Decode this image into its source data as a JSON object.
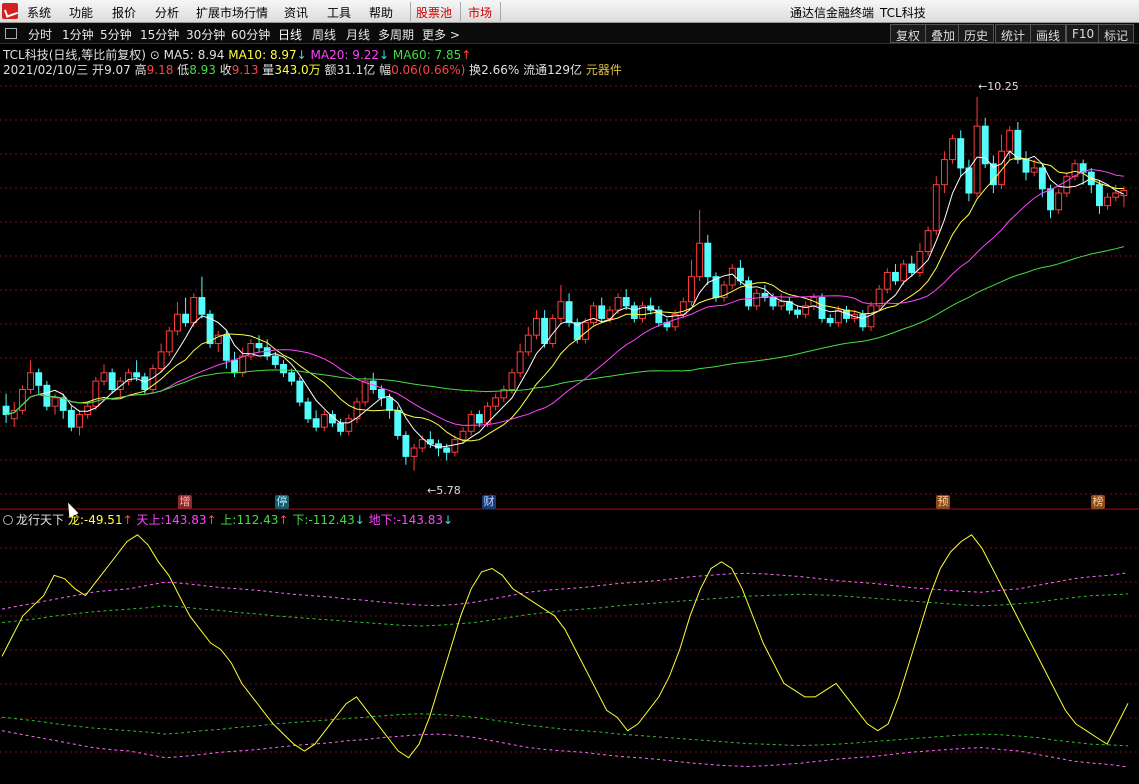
{
  "menu": {
    "items": [
      "系统",
      "功能",
      "报价",
      "分析",
      "扩展市场行情",
      "资讯",
      "工具",
      "帮助"
    ],
    "highlight": [
      "股票池",
      "市场"
    ],
    "app_title": "通达信金融终端",
    "stock_title": "TCL科技"
  },
  "periods": [
    "分时",
    "1分钟",
    "5分钟",
    "15分钟",
    "30分钟",
    "60分钟",
    "日线",
    "周线",
    "月线",
    "多周期",
    "更多 >"
  ],
  "right_buttons": [
    "复权",
    "叠加",
    "历史",
    "统计",
    "画线",
    "F10",
    "标记"
  ],
  "header": {
    "stock": "TCL科技",
    "mode": "(日线,等比前复权)",
    "ma5_label": "MA5:",
    "ma5": "8.94",
    "ma10_label": "MA10:",
    "ma10": "8.97",
    "ma20_label": "MA20:",
    "ma20": "9.22",
    "ma60_label": "MA60:",
    "ma60": "7.85"
  },
  "quote": {
    "date": "2021/02/10/三",
    "open_label": "开",
    "open": "9.07",
    "high_label": "高",
    "high": "9.18",
    "low_label": "低",
    "low": "8.93",
    "close_label": "收",
    "close": "9.13",
    "vol_label": "量",
    "vol": "343.0万",
    "amt_label": "额",
    "amt": "31.1亿",
    "chg_label": "幅",
    "chg": "0.06(0.66%)",
    "turn_label": "换",
    "turn": "2.66%",
    "float_label": "流通",
    "float": "129亿",
    "sector": "元器件"
  },
  "annotations": {
    "high_mark": "10.25",
    "low_mark": "5.78"
  },
  "events": [
    "增",
    "停",
    "财",
    "预",
    "榜"
  ],
  "indicator": {
    "name": "龙行天下",
    "long_label": "龙:",
    "long": "-49.51",
    "up_sky_label": "天上:",
    "up_sky": "143.83",
    "up_label": "上:",
    "up": "112.43",
    "down_label": "下:",
    "down": "-112.43",
    "under_label": "地下:",
    "under": "-143.83"
  },
  "colors": {
    "up": "#ff3c3c",
    "down": "#54fcfc",
    "ma5": "#ffffff",
    "ma10": "#ffff44",
    "ma20": "#ff44ff",
    "ma60": "#44dd44",
    "grid": "#7a1010"
  },
  "chart_data": {
    "type": "candlestick",
    "price_range": [
      5.5,
      10.5
    ],
    "candles": [
      [
        6.55,
        6.45,
        6.7,
        6.35
      ],
      [
        6.4,
        6.5,
        6.6,
        6.3
      ],
      [
        6.5,
        6.75,
        6.8,
        6.45
      ],
      [
        6.75,
        6.95,
        7.1,
        6.7
      ],
      [
        6.95,
        6.8,
        7.0,
        6.7
      ],
      [
        6.8,
        6.55,
        6.85,
        6.5
      ],
      [
        6.55,
        6.65,
        6.7,
        6.45
      ],
      [
        6.65,
        6.5,
        6.7,
        6.4
      ],
      [
        6.5,
        6.3,
        6.55,
        6.25
      ],
      [
        6.3,
        6.45,
        6.5,
        6.2
      ],
      [
        6.45,
        6.55,
        6.6,
        6.4
      ],
      [
        6.55,
        6.85,
        6.9,
        6.5
      ],
      [
        6.85,
        6.95,
        7.05,
        6.8
      ],
      [
        6.95,
        6.75,
        7.0,
        6.7
      ],
      [
        6.75,
        6.85,
        6.9,
        6.65
      ],
      [
        6.85,
        6.95,
        7.0,
        6.8
      ],
      [
        6.95,
        6.9,
        7.1,
        6.85
      ],
      [
        6.9,
        6.75,
        6.95,
        6.7
      ],
      [
        6.75,
        7.0,
        7.05,
        6.7
      ],
      [
        7.0,
        7.2,
        7.3,
        6.95
      ],
      [
        7.2,
        7.45,
        7.5,
        7.15
      ],
      [
        7.45,
        7.65,
        7.8,
        7.4
      ],
      [
        7.65,
        7.55,
        7.85,
        7.5
      ],
      [
        7.55,
        7.85,
        7.9,
        7.5
      ],
      [
        7.85,
        7.65,
        8.1,
        7.6
      ],
      [
        7.65,
        7.3,
        7.7,
        7.25
      ],
      [
        7.3,
        7.4,
        7.45,
        7.2
      ],
      [
        7.4,
        7.1,
        7.45,
        7.0
      ],
      [
        7.1,
        6.95,
        7.2,
        6.9
      ],
      [
        6.95,
        7.15,
        7.25,
        6.9
      ],
      [
        7.15,
        7.3,
        7.35,
        7.1
      ],
      [
        7.3,
        7.25,
        7.4,
        7.2
      ],
      [
        7.25,
        7.15,
        7.35,
        7.1
      ],
      [
        7.15,
        7.05,
        7.2,
        7.0
      ],
      [
        7.05,
        6.95,
        7.1,
        6.9
      ],
      [
        6.95,
        6.85,
        7.0,
        6.8
      ],
      [
        6.85,
        6.6,
        6.9,
        6.55
      ],
      [
        6.6,
        6.4,
        6.65,
        6.35
      ],
      [
        6.4,
        6.3,
        6.5,
        6.25
      ],
      [
        6.3,
        6.45,
        6.5,
        6.25
      ],
      [
        6.45,
        6.35,
        6.5,
        6.3
      ],
      [
        6.35,
        6.25,
        6.4,
        6.2
      ],
      [
        6.25,
        6.4,
        6.45,
        6.2
      ],
      [
        6.4,
        6.6,
        6.65,
        6.35
      ],
      [
        6.6,
        6.85,
        6.9,
        6.55
      ],
      [
        6.85,
        6.75,
        6.95,
        6.7
      ],
      [
        6.75,
        6.65,
        6.8,
        6.55
      ],
      [
        6.65,
        6.5,
        6.7,
        6.4
      ],
      [
        6.5,
        6.2,
        6.55,
        6.15
      ],
      [
        6.2,
        5.95,
        6.25,
        5.85
      ],
      [
        5.95,
        6.05,
        6.1,
        5.78
      ],
      [
        6.05,
        6.15,
        6.2,
        6.0
      ],
      [
        6.15,
        6.1,
        6.25,
        6.05
      ],
      [
        6.1,
        6.05,
        6.15,
        5.95
      ],
      [
        6.05,
        6.0,
        6.1,
        5.9
      ],
      [
        6.0,
        6.15,
        6.2,
        5.95
      ],
      [
        6.15,
        6.25,
        6.3,
        6.1
      ],
      [
        6.25,
        6.45,
        6.5,
        6.2
      ],
      [
        6.45,
        6.35,
        6.5,
        6.3
      ],
      [
        6.35,
        6.55,
        6.6,
        6.3
      ],
      [
        6.55,
        6.65,
        6.7,
        6.5
      ],
      [
        6.65,
        6.75,
        6.8,
        6.6
      ],
      [
        6.75,
        6.95,
        7.0,
        6.7
      ],
      [
        6.95,
        7.2,
        7.3,
        6.9
      ],
      [
        7.2,
        7.4,
        7.5,
        7.15
      ],
      [
        7.4,
        7.6,
        7.7,
        7.35
      ],
      [
        7.6,
        7.3,
        7.7,
        7.25
      ],
      [
        7.3,
        7.6,
        7.65,
        7.25
      ],
      [
        7.6,
        7.8,
        8.0,
        7.55
      ],
      [
        7.8,
        7.55,
        7.9,
        7.5
      ],
      [
        7.55,
        7.35,
        7.6,
        7.3
      ],
      [
        7.35,
        7.55,
        7.6,
        7.3
      ],
      [
        7.55,
        7.75,
        7.8,
        7.5
      ],
      [
        7.75,
        7.6,
        7.85,
        7.55
      ],
      [
        7.6,
        7.7,
        7.75,
        7.55
      ],
      [
        7.7,
        7.85,
        7.9,
        7.65
      ],
      [
        7.85,
        7.75,
        7.95,
        7.7
      ],
      [
        7.75,
        7.6,
        7.8,
        7.55
      ],
      [
        7.6,
        7.75,
        7.8,
        7.55
      ],
      [
        7.75,
        7.7,
        7.85,
        7.65
      ],
      [
        7.7,
        7.55,
        7.75,
        7.5
      ],
      [
        7.55,
        7.5,
        7.6,
        7.45
      ],
      [
        7.5,
        7.65,
        7.7,
        7.45
      ],
      [
        7.65,
        7.8,
        7.85,
        7.6
      ],
      [
        7.8,
        8.1,
        8.3,
        7.75
      ],
      [
        8.1,
        8.5,
        8.9,
        8.05
      ],
      [
        8.5,
        8.1,
        8.6,
        8.0
      ],
      [
        8.1,
        7.85,
        8.15,
        7.8
      ],
      [
        7.85,
        8.0,
        8.05,
        7.8
      ],
      [
        8.0,
        8.2,
        8.25,
        7.95
      ],
      [
        8.2,
        8.05,
        8.3,
        8.0
      ],
      [
        8.05,
        7.75,
        8.1,
        7.7
      ],
      [
        7.75,
        7.9,
        7.95,
        7.7
      ],
      [
        7.9,
        7.85,
        8.0,
        7.8
      ],
      [
        7.85,
        7.75,
        7.9,
        7.7
      ],
      [
        7.75,
        7.8,
        7.9,
        7.7
      ],
      [
        7.8,
        7.7,
        7.85,
        7.65
      ],
      [
        7.7,
        7.65,
        7.75,
        7.6
      ],
      [
        7.65,
        7.75,
        7.8,
        7.6
      ],
      [
        7.75,
        7.85,
        7.9,
        7.7
      ],
      [
        7.85,
        7.6,
        7.9,
        7.55
      ],
      [
        7.6,
        7.55,
        7.65,
        7.5
      ],
      [
        7.55,
        7.7,
        7.75,
        7.5
      ],
      [
        7.7,
        7.6,
        7.75,
        7.55
      ],
      [
        7.6,
        7.65,
        7.7,
        7.55
      ],
      [
        7.65,
        7.5,
        7.7,
        7.45
      ],
      [
        7.5,
        7.75,
        7.8,
        7.45
      ],
      [
        7.75,
        7.95,
        8.0,
        7.7
      ],
      [
        7.95,
        8.15,
        8.2,
        7.9
      ],
      [
        8.15,
        8.05,
        8.25,
        8.0
      ],
      [
        8.05,
        8.25,
        8.3,
        8.0
      ],
      [
        8.25,
        8.15,
        8.35,
        8.1
      ],
      [
        8.15,
        8.4,
        8.5,
        8.1
      ],
      [
        8.4,
        8.65,
        8.7,
        8.35
      ],
      [
        8.65,
        9.2,
        9.3,
        8.6
      ],
      [
        9.2,
        9.5,
        9.6,
        9.1
      ],
      [
        9.5,
        9.75,
        9.8,
        9.45
      ],
      [
        9.75,
        9.4,
        9.85,
        9.3
      ],
      [
        9.4,
        9.1,
        9.5,
        9.0
      ],
      [
        9.1,
        9.9,
        10.25,
        9.05
      ],
      [
        9.9,
        9.45,
        10.0,
        9.4
      ],
      [
        9.45,
        9.2,
        9.55,
        9.1
      ],
      [
        9.2,
        9.6,
        9.8,
        9.15
      ],
      [
        9.6,
        9.85,
        9.9,
        9.5
      ],
      [
        9.85,
        9.5,
        9.95,
        9.45
      ],
      [
        9.5,
        9.35,
        9.6,
        9.25
      ],
      [
        9.35,
        9.4,
        9.5,
        9.3
      ],
      [
        9.4,
        9.15,
        9.45,
        9.05
      ],
      [
        9.15,
        8.9,
        9.2,
        8.8
      ],
      [
        8.9,
        9.1,
        9.15,
        8.85
      ],
      [
        9.1,
        9.3,
        9.35,
        9.05
      ],
      [
        9.3,
        9.45,
        9.5,
        9.25
      ],
      [
        9.45,
        9.35,
        9.5,
        9.2
      ],
      [
        9.35,
        9.2,
        9.4,
        9.1
      ],
      [
        9.2,
        8.95,
        9.25,
        8.85
      ],
      [
        8.95,
        9.05,
        9.1,
        8.9
      ],
      [
        9.05,
        9.1,
        9.2,
        9.0
      ],
      [
        9.07,
        9.13,
        9.18,
        8.93
      ]
    ],
    "indicator_series": {
      "long": [
        20,
        50,
        80,
        95,
        110,
        140,
        135,
        120,
        110,
        130,
        150,
        170,
        190,
        200,
        185,
        160,
        140,
        110,
        80,
        60,
        40,
        30,
        10,
        -20,
        -40,
        -60,
        -80,
        -95,
        -110,
        -120,
        -110,
        -90,
        -70,
        -50,
        -40,
        -60,
        -80,
        -100,
        -120,
        -130,
        -110,
        -70,
        -20,
        30,
        80,
        120,
        145,
        150,
        140,
        120,
        110,
        100,
        90,
        80,
        60,
        30,
        0,
        -30,
        -60,
        -70,
        -90,
        -80,
        -60,
        -40,
        -10,
        30,
        80,
        120,
        150,
        160,
        150,
        120,
        80,
        40,
        10,
        -20,
        -30,
        -40,
        -40,
        -30,
        -20,
        -40,
        -60,
        -80,
        -90,
        -80,
        -40,
        10,
        60,
        110,
        150,
        175,
        190,
        200,
        180,
        150,
        120,
        90,
        60,
        30,
        0,
        -30,
        -60,
        -80,
        -90,
        -100,
        -110,
        -80,
        -49.51
      ],
      "sky": [
        90,
        95,
        100,
        105,
        110,
        115,
        118,
        120,
        125,
        130,
        128,
        125,
        122,
        120,
        118,
        115,
        112,
        110,
        108,
        105,
        103,
        100,
        98,
        96,
        95,
        97,
        100,
        105,
        110,
        115,
        118,
        120,
        122,
        125,
        128,
        130,
        132,
        135,
        138,
        140,
        142,
        143,
        142,
        140,
        138,
        135,
        132,
        130,
        128,
        125,
        122,
        120,
        118,
        116,
        115,
        118,
        120,
        125,
        130,
        135,
        138,
        140,
        143.83
      ],
      "up": [
        70,
        73,
        76,
        80,
        83,
        86,
        88,
        90,
        92,
        95,
        93,
        90,
        88,
        85,
        83,
        80,
        78,
        76,
        74,
        72,
        70,
        68,
        66,
        65,
        66,
        68,
        70,
        74,
        78,
        82,
        85,
        88,
        90,
        92,
        95,
        97,
        99,
        101,
        103,
        105,
        107,
        109,
        110,
        111,
        112,
        111,
        110,
        108,
        106,
        104,
        102,
        100,
        98,
        96,
        95,
        96,
        98,
        100,
        104,
        107,
        110,
        111,
        112.43
      ],
      "down": [
        -70,
        -73,
        -76,
        -80,
        -83,
        -86,
        -88,
        -90,
        -92,
        -95,
        -93,
        -90,
        -88,
        -85,
        -83,
        -80,
        -78,
        -76,
        -74,
        -72,
        -70,
        -68,
        -66,
        -65,
        -66,
        -68,
        -70,
        -74,
        -78,
        -82,
        -85,
        -88,
        -90,
        -92,
        -95,
        -97,
        -99,
        -101,
        -103,
        -105,
        -107,
        -109,
        -110,
        -111,
        -112,
        -111,
        -110,
        -108,
        -106,
        -104,
        -102,
        -100,
        -98,
        -96,
        -95,
        -96,
        -98,
        -100,
        -104,
        -107,
        -110,
        -111,
        -112.43
      ],
      "ground": [
        -90,
        -95,
        -100,
        -105,
        -110,
        -115,
        -118,
        -120,
        -125,
        -130,
        -128,
        -125,
        -122,
        -120,
        -118,
        -115,
        -112,
        -110,
        -108,
        -105,
        -103,
        -100,
        -98,
        -96,
        -95,
        -97,
        -100,
        -105,
        -110,
        -115,
        -118,
        -120,
        -122,
        -125,
        -128,
        -130,
        -132,
        -135,
        -138,
        -140,
        -142,
        -143,
        -142,
        -140,
        -138,
        -135,
        -132,
        -130,
        -128,
        -125,
        -122,
        -120,
        -118,
        -116,
        -115,
        -118,
        -120,
        -125,
        -130,
        -135,
        -138,
        -140,
        -143.83
      ]
    },
    "indicator_range": [
      -160,
      210
    ]
  }
}
